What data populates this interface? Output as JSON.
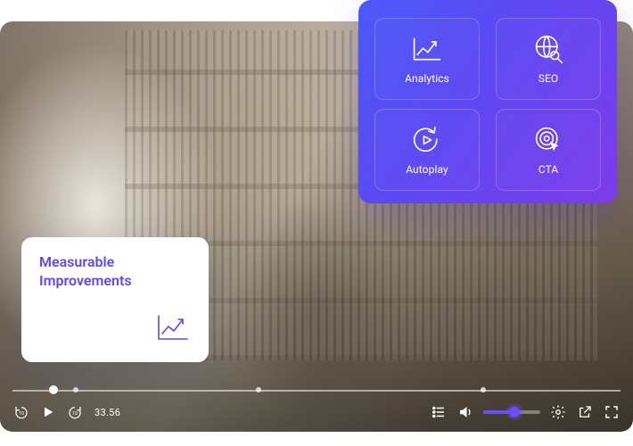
{
  "colors": {
    "accent": "#5b49f3",
    "panel_gradient_start": "#4a5af8",
    "panel_gradient_end": "#7e3bea"
  },
  "feature_panel": {
    "items": [
      {
        "label": "Analytics",
        "icon": "chart-up-icon"
      },
      {
        "label": "SEO",
        "icon": "globe-search-icon"
      },
      {
        "label": "Autoplay",
        "icon": "replay-play-icon"
      },
      {
        "label": "CTA",
        "icon": "target-click-icon"
      }
    ]
  },
  "improvements_card": {
    "title_line1": "Measurable",
    "title_line2": "Improvements"
  },
  "player": {
    "time": "33.56",
    "progress_percent": 6,
    "chapter_marks_percent": [
      10,
      40,
      77
    ],
    "volume_percent": 55
  }
}
